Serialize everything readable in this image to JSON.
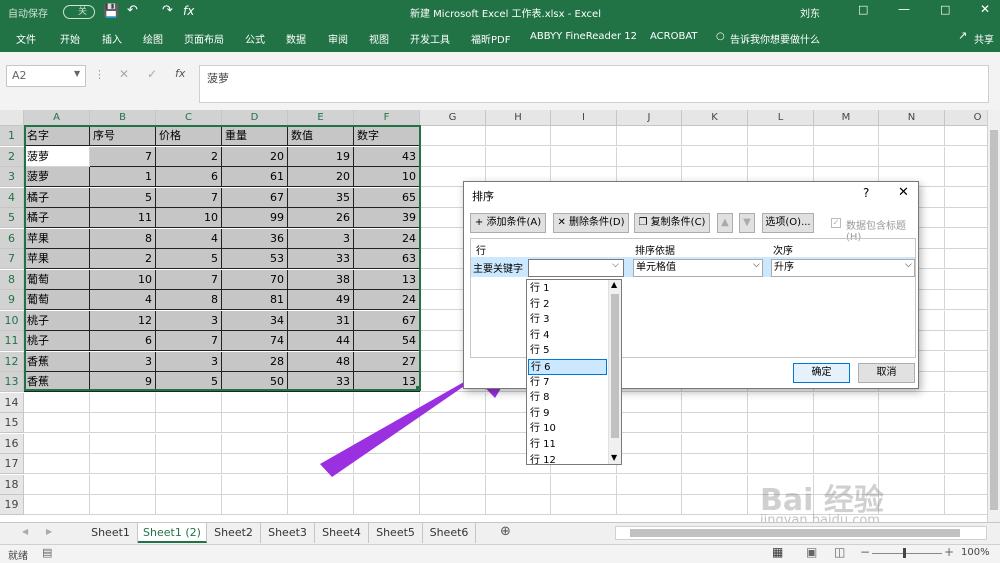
{
  "title": {
    "autosave": "自动保存",
    "autosave_state": "关",
    "doc": "新建 Microsoft Excel 工作表.xlsx - Excel",
    "user": "刘东",
    "fx": "fx"
  },
  "ribbon": {
    "tabs": [
      "文件",
      "开始",
      "插入",
      "绘图",
      "页面布局",
      "公式",
      "数据",
      "审阅",
      "视图",
      "开发工具",
      "福昕PDF",
      "ABBYY FineReader 12",
      "ACROBAT"
    ],
    "tell": "告诉我你想要做什么",
    "share": "共享"
  },
  "formula": {
    "namebox": "A2",
    "content": "菠萝"
  },
  "columns": [
    "A",
    "B",
    "C",
    "D",
    "E",
    "F",
    "G",
    "H",
    "I",
    "J",
    "K",
    "L",
    "M",
    "N",
    "O"
  ],
  "rows": [
    "1",
    "2",
    "3",
    "4",
    "5",
    "6",
    "7",
    "8",
    "9",
    "10",
    "11",
    "12",
    "13",
    "14",
    "15",
    "16",
    "17",
    "18",
    "19"
  ],
  "table": {
    "headers": [
      "名字",
      "序号",
      "价格",
      "重量",
      "数值",
      "数字"
    ],
    "data": [
      [
        "菠萝",
        "7",
        "2",
        "20",
        "19",
        "43"
      ],
      [
        "菠萝",
        "1",
        "6",
        "61",
        "20",
        "10"
      ],
      [
        "橘子",
        "5",
        "7",
        "67",
        "35",
        "65"
      ],
      [
        "橘子",
        "11",
        "10",
        "99",
        "26",
        "39"
      ],
      [
        "苹果",
        "8",
        "4",
        "36",
        "3",
        "24"
      ],
      [
        "苹果",
        "2",
        "5",
        "53",
        "33",
        "63"
      ],
      [
        "葡萄",
        "10",
        "7",
        "70",
        "38",
        "13"
      ],
      [
        "葡萄",
        "4",
        "8",
        "81",
        "49",
        "24"
      ],
      [
        "桃子",
        "12",
        "3",
        "34",
        "31",
        "67"
      ],
      [
        "桃子",
        "6",
        "7",
        "74",
        "44",
        "54"
      ],
      [
        "香蕉",
        "3",
        "3",
        "28",
        "48",
        "27"
      ],
      [
        "香蕉",
        "9",
        "5",
        "50",
        "33",
        "13"
      ]
    ]
  },
  "dialog": {
    "title": "排序",
    "help": "?",
    "add": "添加条件(A)",
    "delete": "删除条件(D)",
    "copy": "复制条件(C)",
    "options": "选项(O)...",
    "has_header": "数据包含标题(H)",
    "col_header1": "行",
    "col_header2": "排序依据",
    "col_header3": "次序",
    "row_label": "主要关键字",
    "sort_on": "单元格值",
    "order": "升序",
    "ok": "确定",
    "cancel": "取消"
  },
  "dropdown": {
    "items": [
      "行 1",
      "行 2",
      "行 3",
      "行 4",
      "行 5",
      "行 6",
      "行 7",
      "行 8",
      "行 9",
      "行 10",
      "行 11",
      "行 12"
    ],
    "selected": "行 6"
  },
  "sheets": [
    "Sheet1",
    "Sheet1 (2)",
    "Sheet2",
    "Sheet3",
    "Sheet4",
    "Sheet5",
    "Sheet6"
  ],
  "active_sheet": "Sheet1 (2)",
  "status": {
    "ready": "就绪",
    "zoom": "100%"
  },
  "watermark": {
    "brand": "Bai 经验",
    "url": "jingyan.baidu.com"
  },
  "colors": {
    "excel_green": "#217346",
    "selection": "#c6c6c6",
    "highlight": "#cce8ff",
    "arrow": "#9b30e0"
  }
}
